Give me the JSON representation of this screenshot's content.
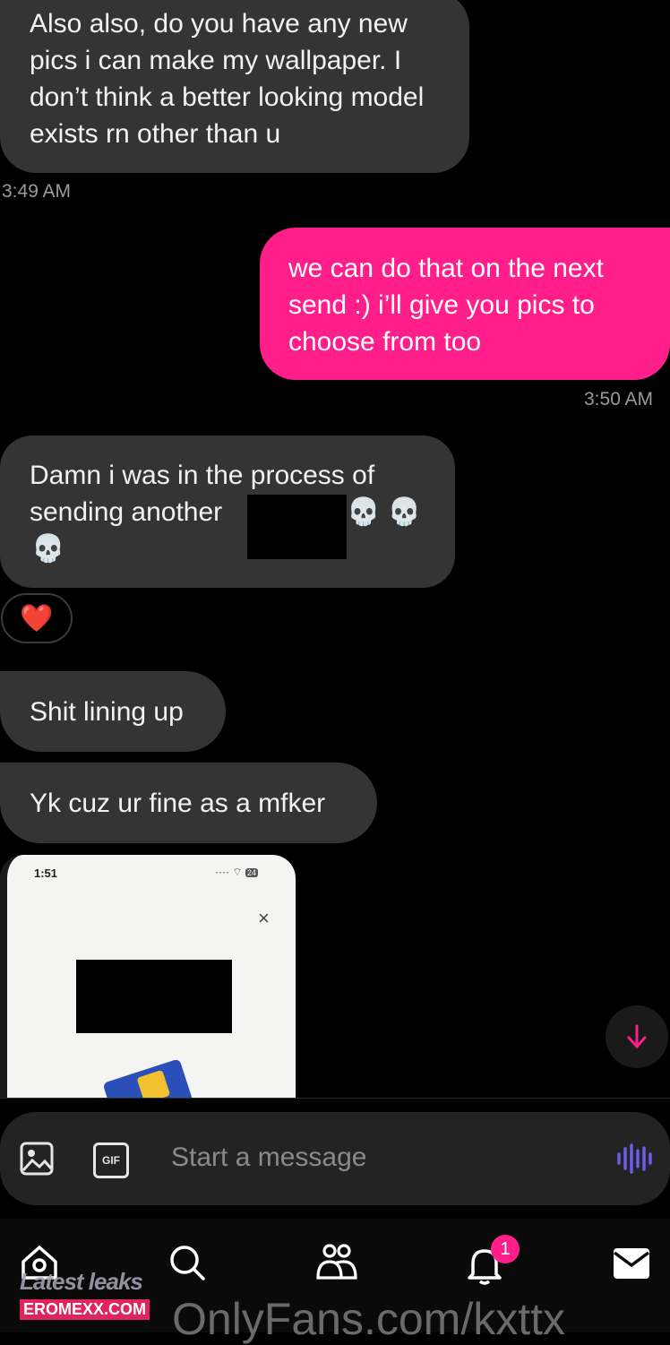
{
  "messages": [
    {
      "id": "m1",
      "text": "Also also, do you have any new pics i can make my wallpaper. I don’t think a better looking model exists rn other than u",
      "time": "3:49 AM"
    },
    {
      "id": "m2",
      "text": "we can do that on the next send :) i’ll give you pics to choose from too",
      "time": "3:50 AM"
    },
    {
      "id": "m3_line1",
      "text": "Damn i was in the process of"
    },
    {
      "id": "m3_line2",
      "text": "sending another"
    },
    {
      "id": "m3_emoji",
      "text": "💀 💀"
    },
    {
      "id": "m3_emoji2",
      "text": "💀"
    },
    {
      "id": "m4",
      "text": "Shit lining up"
    },
    {
      "id": "m5",
      "text": "Yk cuz ur fine as a mfker"
    }
  ],
  "reaction": "❤️",
  "image_preview": {
    "status_time": "1:51",
    "battery": "24",
    "close": "×"
  },
  "composer": {
    "placeholder": "Start a message",
    "gif_label": "GIF"
  },
  "nav": {
    "notifications_badge": "1"
  },
  "watermark": {
    "small": "Latest leaks",
    "tag": "EROMEXX.COM",
    "big": "OnlyFans.com/kxttx"
  },
  "colors": {
    "outgoing": "#ff1e8a",
    "incoming": "#343434",
    "accent_icon": "#6c5ce7"
  }
}
